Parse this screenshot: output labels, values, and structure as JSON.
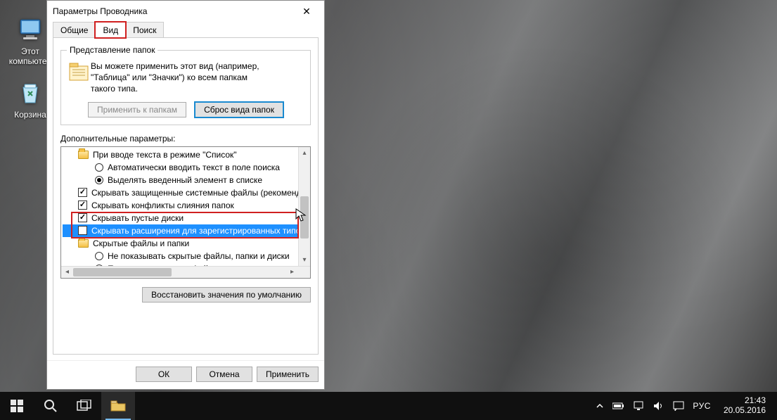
{
  "desktop": {
    "icons": [
      {
        "id": "this-pc",
        "label": "Этот компьютер"
      },
      {
        "id": "recycle-bin",
        "label": "Корзина"
      }
    ]
  },
  "dialog": {
    "title": "Параметры Проводника",
    "tabs": {
      "general": "Общие",
      "view": "Вид",
      "search": "Поиск"
    },
    "groupbox": {
      "legend": "Представление папок",
      "text_line1": "Вы можете применить этот вид (например,",
      "text_line2": "\"Таблица\" или \"Значки\") ко всем папкам",
      "text_line3": "такого типа.",
      "apply_btn": "Применить к папкам",
      "reset_btn": "Сброс вида папок"
    },
    "advanced_label": "Дополнительные параметры:",
    "tree": {
      "n0": "При вводе текста в режиме \"Список\"",
      "n1": "Автоматически вводить текст в поле поиска",
      "n2": "Выделять введенный элемент в списке",
      "n3": "Скрывать защищенные системные файлы (рекоменд",
      "n4": "Скрывать конфликты слияния папок",
      "n5": "Скрывать пустые диски",
      "n6": "Скрывать расширения для зарегистрированных типов",
      "n7": "Скрытые файлы и папки",
      "n8": "Не показывать скрытые файлы, папки и диски",
      "n9": "Показывать скрытые файлы, папки и диски"
    },
    "restore_btn": "Восстановить значения по умолчанию",
    "buttons": {
      "ok": "ОК",
      "cancel": "Отмена",
      "apply": "Применить"
    }
  },
  "taskbar": {
    "lang": "РУС",
    "time": "21:43",
    "date": "20.05.2016"
  }
}
